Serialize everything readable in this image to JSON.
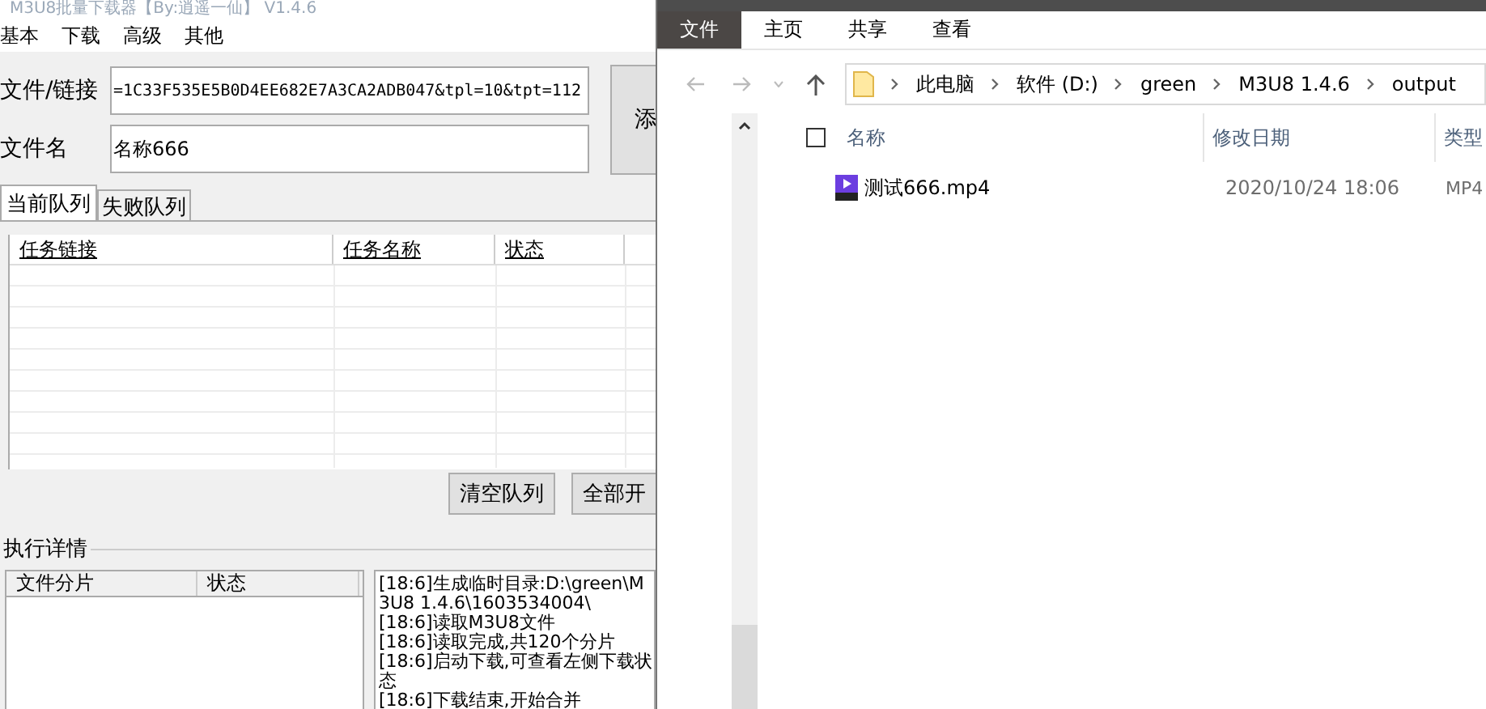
{
  "left_window": {
    "title": "M3U8批量下载器【By:逍遥一仙】 V1.4.6",
    "menu": [
      "基本",
      "下载",
      "高级",
      "其他"
    ],
    "fields": [
      {
        "label": "文件/链接",
        "value": "=1C33F535E5B0D4EE682E7A3CA2ADB047&tpl=10&tpt=112"
      },
      {
        "label": "文件名",
        "value": "名称666"
      }
    ],
    "add_button": "添",
    "tabs": [
      {
        "label": "当前队列",
        "selected": true
      },
      {
        "label": "失败队列",
        "selected": false
      }
    ],
    "queue_table": {
      "columns": [
        "任务链接",
        "任务名称",
        "状态"
      ]
    },
    "buttons": [
      "清空队列",
      "全部开"
    ],
    "details": {
      "title": "执行详情",
      "segments_table": {
        "columns": [
          "文件分片",
          "状态"
        ]
      },
      "log": [
        "[18:6]生成临时目录:D:\\green\\M3U8 1.4.6\\1603534004\\",
        "[18:6]读取M3U8文件",
        "[18:6]读取完成,共120个分片",
        "[18:6]启动下载,可查看左侧下载状态",
        "[18:6]下载结束,开始合并"
      ]
    }
  },
  "explorer": {
    "ribbon_tabs": [
      {
        "label": "文件",
        "selected": true
      },
      {
        "label": "主页",
        "selected": false
      },
      {
        "label": "共享",
        "selected": false
      },
      {
        "label": "查看",
        "selected": false
      }
    ],
    "breadcrumb": [
      "此电脑",
      "软件 (D:)",
      "green",
      "M3U8 1.4.6",
      "output"
    ],
    "select_all": {
      "checked": false
    },
    "columns": [
      "名称",
      "修改日期",
      "类型"
    ],
    "files": [
      {
        "name": "测试666.mp4",
        "modified": "2020/10/24 18:06",
        "type": "MP4"
      }
    ]
  }
}
